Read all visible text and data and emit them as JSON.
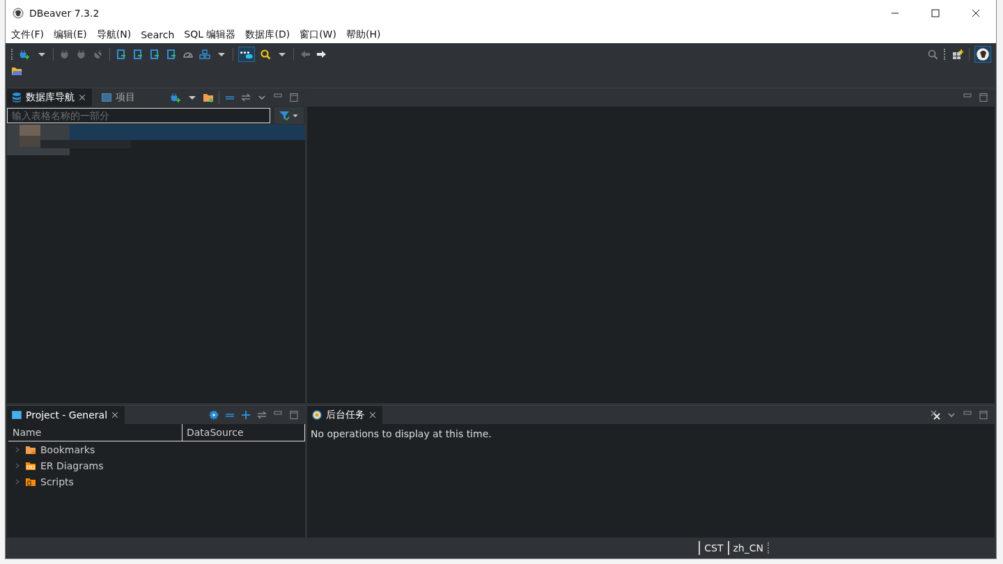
{
  "window": {
    "title": "DBeaver 7.3.2"
  },
  "menu": [
    "文件(F)",
    "编辑(E)",
    "导航(N)",
    "Search",
    "SQL 编辑器",
    "数据库(D)",
    "窗口(W)",
    "帮助(H)"
  ],
  "toolbar": {
    "toggle": {
      "selected": true
    }
  },
  "navigator": {
    "tabs": [
      {
        "label": "数据库导航",
        "selected": true
      },
      {
        "label": "项目",
        "selected": false
      }
    ],
    "filter": {
      "placeholder": "输入表格名称的一部分"
    }
  },
  "project": {
    "tab": "Project - General",
    "columns": [
      "Name",
      "DataSource"
    ],
    "items": [
      {
        "label": "Bookmarks",
        "kind": "bookmarks",
        "expanded": false
      },
      {
        "label": "ER Diagrams",
        "kind": "diagrams",
        "expanded": false
      },
      {
        "label": "Scripts",
        "kind": "scripts",
        "expanded": false
      }
    ]
  },
  "tasks": {
    "tab": "后台任务",
    "message": "No operations to display at this time."
  },
  "status_bar": [
    "CST",
    "zh_CN"
  ]
}
